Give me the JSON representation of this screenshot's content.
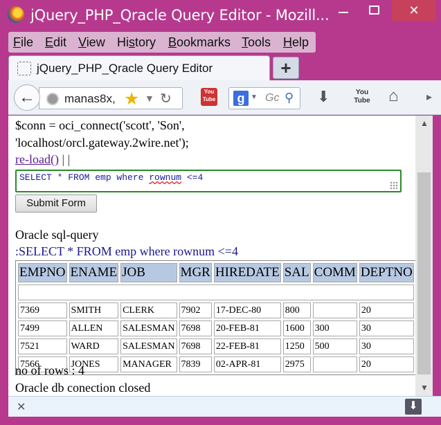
{
  "window": {
    "title": "jQuery_PHP_Qracle Query Editor - Mozill...",
    "min_symbol": "—",
    "close_symbol": "✕"
  },
  "menu": {
    "items": [
      {
        "accel": "F",
        "rest": "ile"
      },
      {
        "accel": "E",
        "rest": "dit"
      },
      {
        "accel": "V",
        "rest": "iew"
      },
      {
        "pre": "Hi",
        "accel": "s",
        "rest": "tory"
      },
      {
        "accel": "B",
        "rest": "ookmarks"
      },
      {
        "accel": "T",
        "rest": "ools"
      },
      {
        "accel": "H",
        "rest": "elp"
      }
    ]
  },
  "tab": {
    "title": "jQuery_PHP_Qracle Query Editor",
    "new_tab_symbol": "+"
  },
  "navbar": {
    "back_symbol": "←",
    "url": "manas8x,",
    "search_engine": "g",
    "search_placeholder": "Gc",
    "youtube_label": "You Tube"
  },
  "page": {
    "code_line1": "$conn = oci_connect('scott', 'Son',",
    "code_line2": "'localhost/orcl.gateway.2wire.net');",
    "reload_link": "re-load()",
    "separators": " | |",
    "query_prefix": "SELECT * FROM emp where ",
    "query_misspelled": "rownum",
    "query_suffix": " <=4",
    "submit_label": "Submit Form",
    "section_label": "Oracle sql-query",
    "query_echo": ":SELECT * FROM emp where rownum <=4",
    "row_count": "no of rows : 4",
    "closed_msg": "Oracle db conection closed"
  },
  "table": {
    "columns": [
      "EMPNO",
      "ENAME",
      "JOB",
      "MGR",
      "HIREDATE",
      "SAL",
      "COMM",
      "DEPTNO"
    ],
    "rows": [
      [
        "7369",
        "SMITH",
        "CLERK",
        "7902",
        "17-DEC-80",
        "800",
        "",
        "20"
      ],
      [
        "7499",
        "ALLEN",
        "SALESMAN",
        "7698",
        "20-FEB-81",
        "1600",
        "300",
        "30"
      ],
      [
        "7521",
        "WARD",
        "SALESMAN",
        "7698",
        "22-FEB-81",
        "1250",
        "500",
        "30"
      ],
      [
        "7566",
        "JONES",
        "MANAGER",
        "7839",
        "02-APR-81",
        "2975",
        "",
        "20"
      ]
    ]
  },
  "icons": {
    "star": "★",
    "reload": "↻",
    "magnifier": "⚲",
    "download": "⬇",
    "home": "⌂",
    "close": "✕"
  },
  "colors": {
    "frame": "#b6398e",
    "close_button": "#c7415c",
    "header_cell": "#b7c9e2",
    "query_border": "#2a8a2a",
    "link": "#5a1a8c"
  }
}
